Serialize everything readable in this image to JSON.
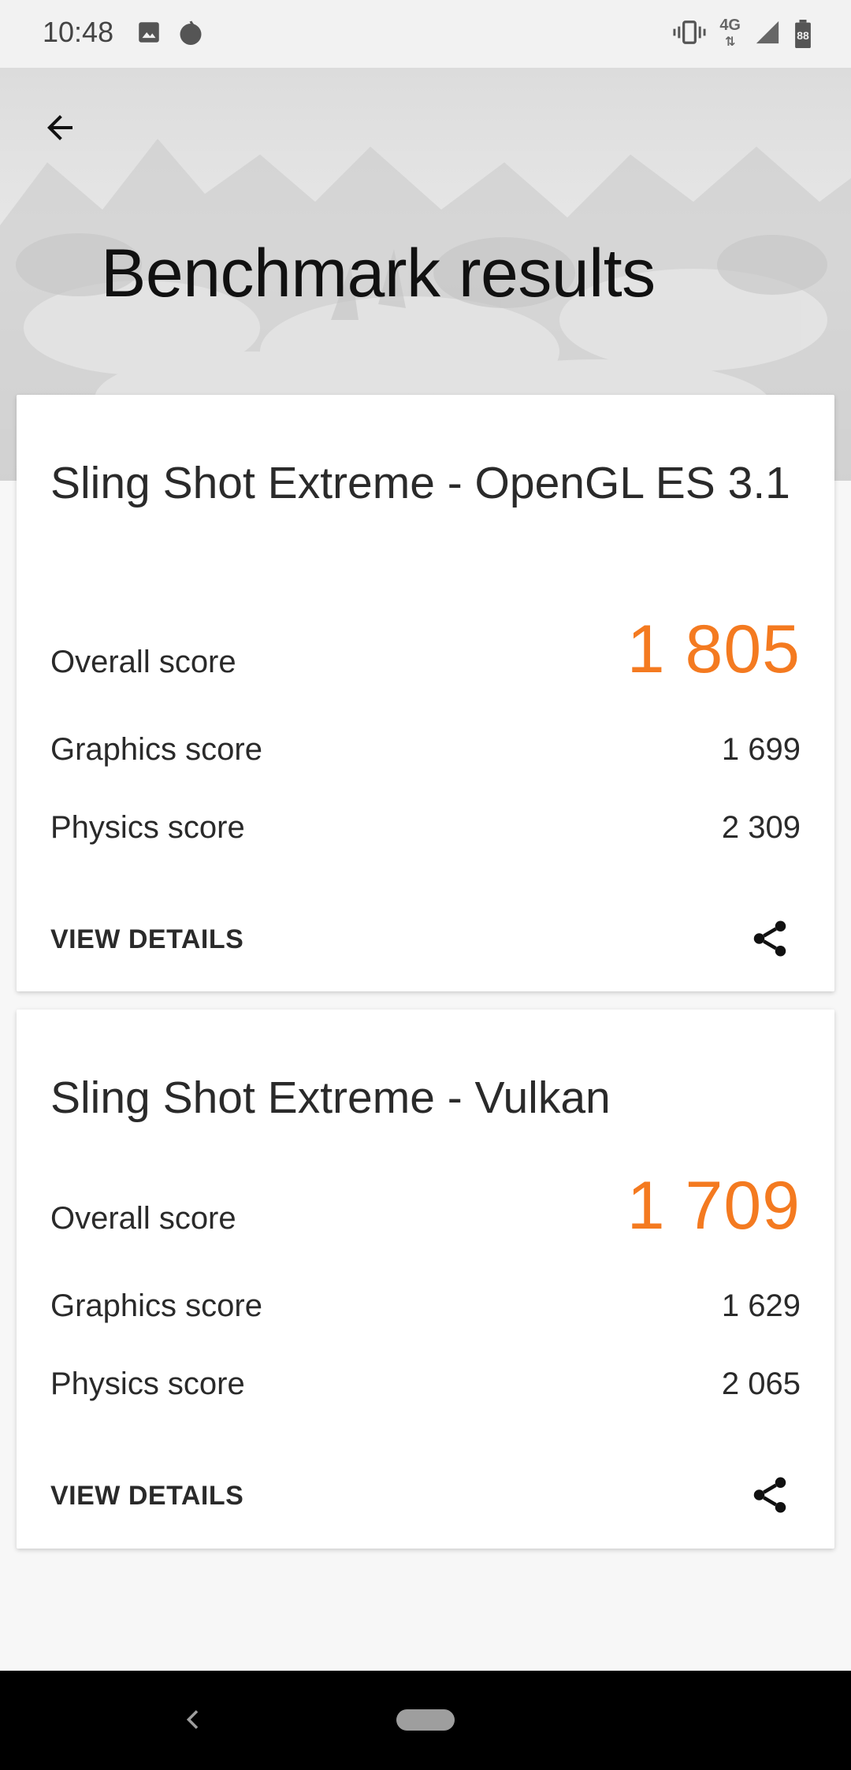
{
  "status_bar": {
    "time": "10:48",
    "network": "4G",
    "battery": "88",
    "icons": [
      "image-icon",
      "flame-icon",
      "vibrate-icon",
      "signal-icon",
      "battery-icon"
    ]
  },
  "header": {
    "title": "Benchmark results",
    "back_icon": "arrow-left-icon"
  },
  "results": [
    {
      "title": "Sling Shot Extreme - OpenGL ES 3.1",
      "overall_label": "Overall score",
      "overall_value": "1 805",
      "graphics_label": "Graphics score",
      "graphics_value": "1 699",
      "physics_label": "Physics score",
      "physics_value": "2 309",
      "view_details": "VIEW DETAILS",
      "share_icon": "share-icon"
    },
    {
      "title": "Sling Shot Extreme - Vulkan",
      "overall_label": "Overall score",
      "overall_value": "1 709",
      "graphics_label": "Graphics score",
      "graphics_value": "1 629",
      "physics_label": "Physics score",
      "physics_value": "2 065",
      "view_details": "VIEW DETAILS",
      "share_icon": "share-icon"
    }
  ],
  "nav_bar": {
    "icons": [
      "nav-back-icon",
      "nav-home-pill"
    ]
  },
  "colors": {
    "accent": "#f47a20",
    "text": "#2a2a2a",
    "background": "#f7f7f7"
  }
}
